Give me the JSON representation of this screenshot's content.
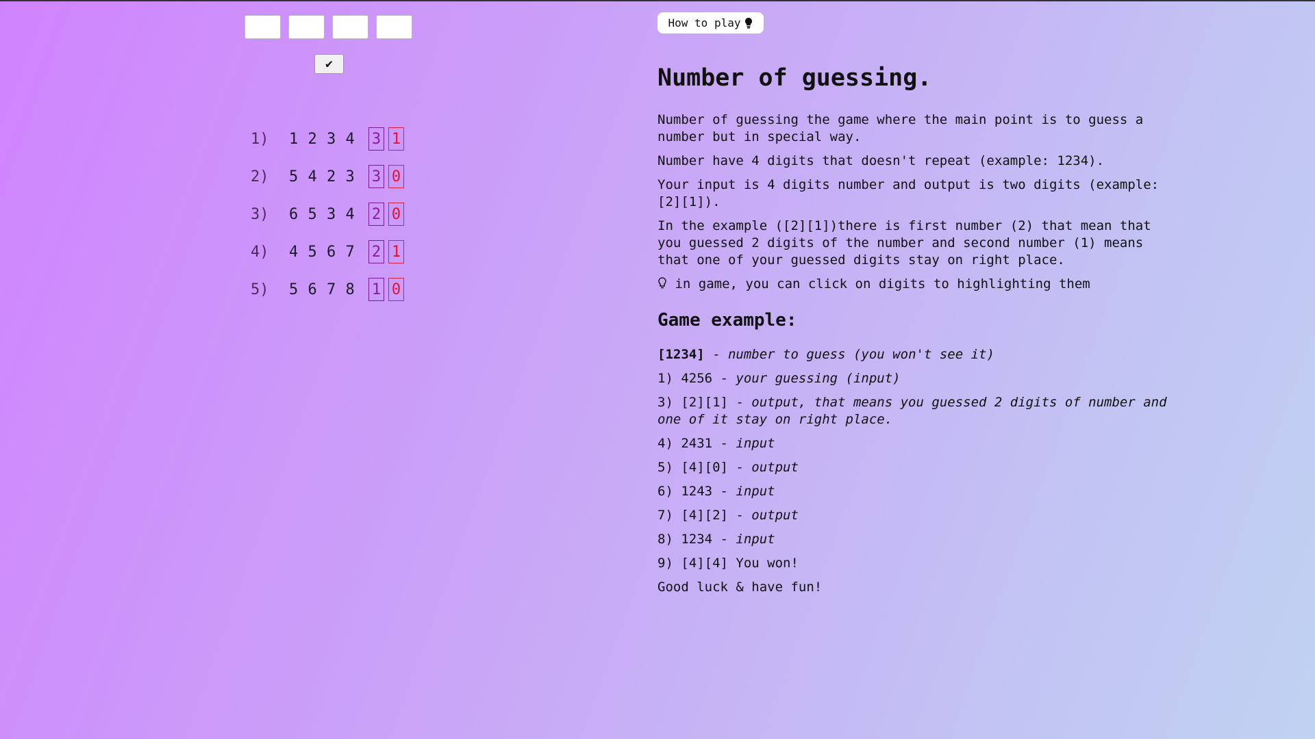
{
  "game": {
    "inputs": [
      "",
      "",
      "",
      ""
    ],
    "submit_icon": "check-icon",
    "guesses": [
      {
        "label": "1)",
        "digits": [
          "1",
          "2",
          "3",
          "4"
        ],
        "found": "3",
        "placed": "1"
      },
      {
        "label": "2)",
        "digits": [
          "5",
          "4",
          "2",
          "3"
        ],
        "found": "3",
        "placed": "0"
      },
      {
        "label": "3)",
        "digits": [
          "6",
          "5",
          "3",
          "4"
        ],
        "found": "2",
        "placed": "0"
      },
      {
        "label": "4)",
        "digits": [
          "4",
          "5",
          "6",
          "7"
        ],
        "found": "2",
        "placed": "1"
      },
      {
        "label": "5)",
        "digits": [
          "5",
          "6",
          "7",
          "8"
        ],
        "found": "1",
        "placed": "0"
      }
    ]
  },
  "help": {
    "button_label": "How to play",
    "button_icon": "lightbulb-icon",
    "title": "Number of guessing.",
    "paragraphs": [
      "Number of guessing the game where the main point is to guess a number but in special way.",
      "Number have 4 digits that doesn't repeat (example: 1234).",
      "Your input is 4 digits number and output is two digits (example: [2][1]).",
      "In the example ([2][1])there is first number (2) that mean that you guessed 2 digits of the number and second number (1) means that one of your guessed digits stay on right place."
    ],
    "tip": "in game, you can click on digits to highlighting them",
    "example_title": "Game example:",
    "example": [
      {
        "pre": "[1234]",
        "mid": " - ",
        "em": "number to guess (you won't see it)"
      },
      {
        "pre": "1) 4256",
        "mid": " - ",
        "em": "your guessing (input)"
      },
      {
        "pre": "3) [2][1]",
        "mid": " - ",
        "em": "output, that means you guessed 2 digits of number and one of it stay on right place."
      },
      {
        "pre": "4) 2431",
        "mid": " - ",
        "em": "input"
      },
      {
        "pre": "5) [4][0]",
        "mid": " - ",
        "em": "output"
      },
      {
        "pre": "6) 1243",
        "mid": " - ",
        "em": "input"
      },
      {
        "pre": "7) [4][2]",
        "mid": " - ",
        "em": "output"
      },
      {
        "pre": "8) 1234",
        "mid": " - ",
        "em": "input"
      },
      {
        "pre": "9) [4][4] You won!",
        "mid": "",
        "em": ""
      }
    ],
    "closing": "Good luck & have fun!"
  }
}
